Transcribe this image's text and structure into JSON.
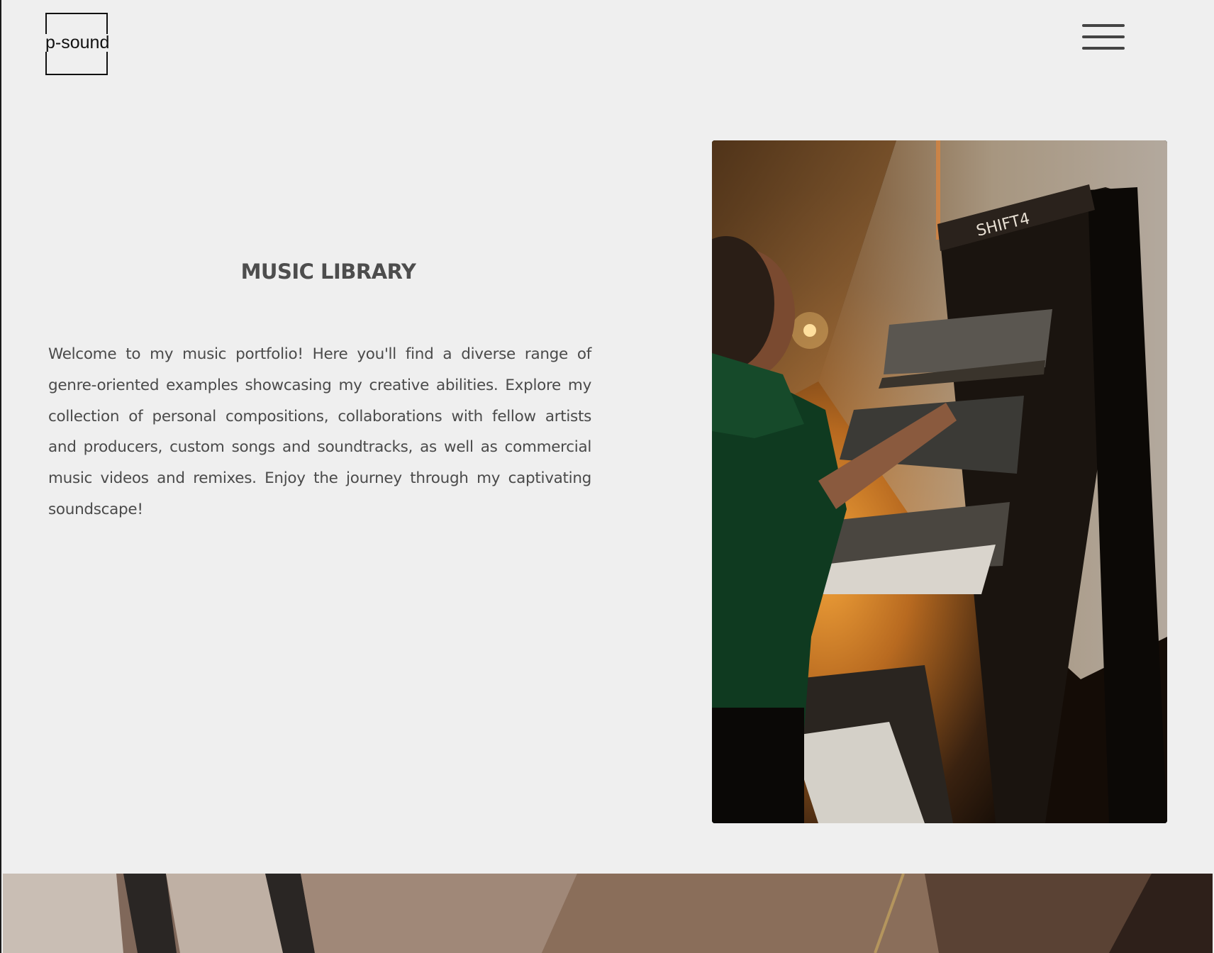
{
  "header": {
    "logo_text": "p-sound",
    "menu_icon": "hamburger-menu-icon"
  },
  "intro": {
    "title": "MUSIC LIBRARY",
    "body": "Welcome to my music portfolio! Here you'll find a diverse range of genre-oriented examples showcasing my creative abilities. Explore my collection of personal compositions, collaborations with fellow artists and producers, custom songs and soundtracks, as well as commercial music videos and remixes. Enjoy the journey through my captivating soundscape!"
  },
  "photo": {
    "rack_label": "SHIFT4"
  },
  "colors": {
    "background": "#efefef",
    "text": "#4a4a4a",
    "heading": "#4d4d4d",
    "logo": "#111111"
  }
}
